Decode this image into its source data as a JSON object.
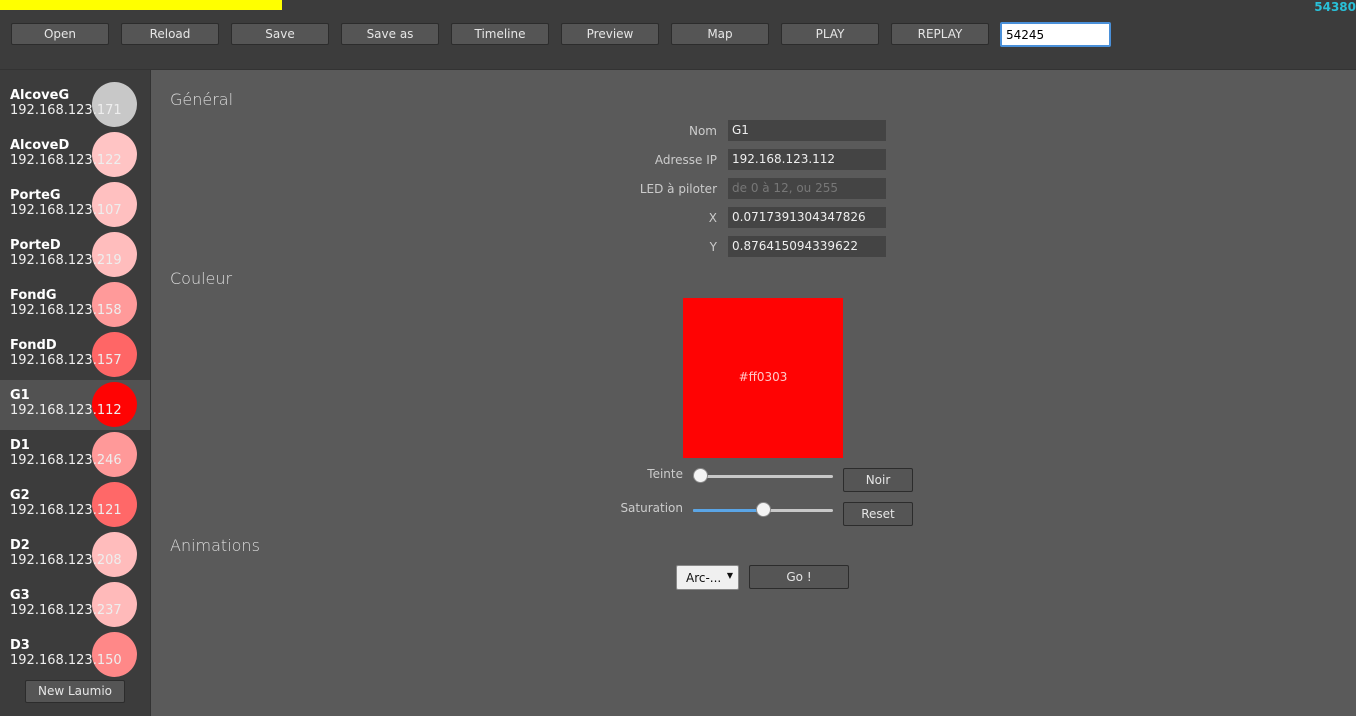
{
  "topbar": {
    "port_readout": "54380",
    "buttons": [
      "Open",
      "Reload",
      "Save",
      "Save as",
      "Timeline",
      "Preview",
      "Map",
      "PLAY",
      "REPLAY"
    ],
    "port_input_value": "54245"
  },
  "sidebar": {
    "devices": [
      {
        "name": "AlcoveG",
        "ip": "192.168.123.171",
        "color": "#c8c8c8"
      },
      {
        "name": "AlcoveD",
        "ip": "192.168.123.122",
        "color": "#ffc4c4"
      },
      {
        "name": "PorteG",
        "ip": "192.168.123.107",
        "color": "#ffc0c0"
      },
      {
        "name": "PorteD",
        "ip": "192.168.123.219",
        "color": "#ffbdbd"
      },
      {
        "name": "FondG",
        "ip": "192.168.123.158",
        "color": "#ff9a9a"
      },
      {
        "name": "FondD",
        "ip": "192.168.123.157",
        "color": "#ff6666"
      },
      {
        "name": "G1",
        "ip": "192.168.123.112",
        "color": "#ff0303"
      },
      {
        "name": "D1",
        "ip": "192.168.123.246",
        "color": "#ff9999"
      },
      {
        "name": "G2",
        "ip": "192.168.123.121",
        "color": "#ff6868"
      },
      {
        "name": "D2",
        "ip": "192.168.123.208",
        "color": "#ffbcbc"
      },
      {
        "name": "G3",
        "ip": "192.168.123.237",
        "color": "#ffbaba"
      },
      {
        "name": "D3",
        "ip": "192.168.123.150",
        "color": "#ff8888"
      }
    ],
    "active_index": 6,
    "new_button": "New Laumio"
  },
  "general": {
    "title": "Général",
    "fields": [
      {
        "label": "Nom",
        "value": "G1",
        "placeholder": ""
      },
      {
        "label": "Adresse IP",
        "value": "192.168.123.112",
        "placeholder": ""
      },
      {
        "label": "LED à piloter",
        "value": "",
        "placeholder": "de 0 à 12, ou 255"
      },
      {
        "label": "X",
        "value": "0.0717391304347826",
        "placeholder": ""
      },
      {
        "label": "Y",
        "value": "0.876415094339622",
        "placeholder": ""
      }
    ]
  },
  "couleur": {
    "title": "Couleur",
    "hex": "#ff0303",
    "teinte_label": "Teinte",
    "teinte_value": 0.0,
    "saturation_label": "Saturation",
    "saturation_value": 0.5,
    "noir_button": "Noir",
    "reset_button": "Reset"
  },
  "animations": {
    "title": "Animations",
    "select_value": "Arc-...",
    "go_button": "Go !"
  }
}
